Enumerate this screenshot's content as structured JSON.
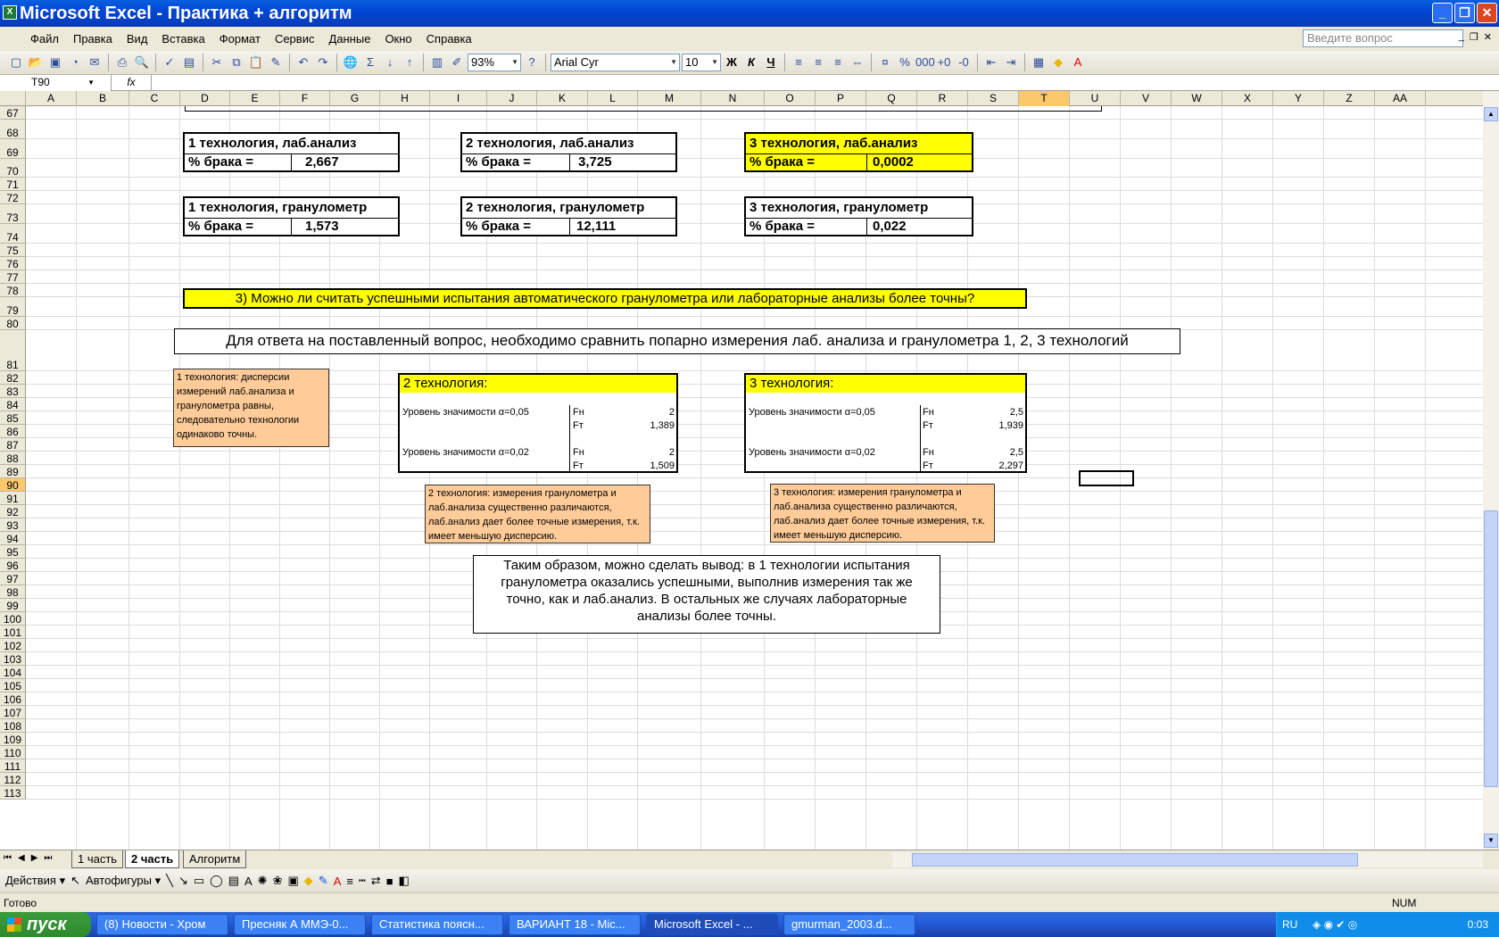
{
  "window": {
    "title": "Microsoft Excel - Практика + алгоритм"
  },
  "menu": {
    "items": [
      "Файл",
      "Правка",
      "Вид",
      "Вставка",
      "Формат",
      "Сервис",
      "Данные",
      "Окно",
      "Справка"
    ],
    "ask_placeholder": "Введите вопрос"
  },
  "toolbar": {
    "zoom": "93%",
    "font": "Arial Cyr",
    "size": "10",
    "bold": "Ж",
    "italic": "К",
    "underline": "Ч"
  },
  "formula": {
    "name_box": "T90",
    "fx": "fx",
    "content": ""
  },
  "columns": [
    "A",
    "B",
    "C",
    "D",
    "E",
    "F",
    "G",
    "H",
    "I",
    "J",
    "K",
    "L",
    "M",
    "N",
    "O",
    "P",
    "Q",
    "R",
    "S",
    "T",
    "U",
    "V",
    "W",
    "X",
    "Y",
    "Z",
    "AA"
  ],
  "rows": [
    "67",
    "68",
    "69",
    "70",
    "71",
    "72",
    "73",
    "74",
    "75",
    "76",
    "77",
    "78",
    "79",
    "80",
    "81",
    "82",
    "83",
    "84",
    "85",
    "86",
    "87",
    "88",
    "89",
    "90",
    "91",
    "92",
    "93",
    "94",
    "95",
    "96",
    "97",
    "98",
    "99",
    "100",
    "101",
    "102",
    "103",
    "104",
    "105",
    "106",
    "107",
    "108",
    "109",
    "110",
    "111",
    "112",
    "113"
  ],
  "active": {
    "column": "T",
    "row": "90"
  },
  "blocks": {
    "t1_lab": {
      "title": "1 технология, лаб.анализ",
      "label": "% брака =",
      "value": "2,667"
    },
    "t2_lab": {
      "title": "2 технология, лаб.анализ",
      "label": "% брака =",
      "value": "3,725"
    },
    "t3_lab": {
      "title": "3 технология, лаб.анализ",
      "label": "% брака =",
      "value": "0,0002"
    },
    "t1_gran": {
      "title": "1 технология, гранулометр",
      "label": "% брака =",
      "value": "1,573"
    },
    "t2_gran": {
      "title": "2 технология, гранулометр",
      "label": "% брака =",
      "value": "12,111"
    },
    "t3_gran": {
      "title": "3 технология, гранулометр",
      "label": "% брака =",
      "value": "0,022"
    }
  },
  "question": "3) Можно ли считать успешными испытания автоматического гранулометра или лабораторные анализы более точны?",
  "heading": "Для ответа на поставленный вопрос, необходимо сравнить попарно измерения лаб. анализа и гранулометра 1, 2, 3 технологий",
  "note1": "1 технология: дисперсии измерений лаб.анализа и гранулометра равны, следовательно технологии одинаково точны.",
  "tech2": {
    "title": "2 технология:",
    "l1": "Уровень значимости α=0,05",
    "fn1": "Fн",
    "fn1v": "2",
    "ft1": "Fт",
    "ft1v": "1,389",
    "l2": "Уровень значимости α=0,02",
    "fn2": "Fн",
    "fn2v": "2",
    "ft2": "Fт",
    "ft2v": "1,509"
  },
  "tech3": {
    "title": "3 технология:",
    "l1": "Уровень значимости α=0,05",
    "fn1": "Fн",
    "fn1v": "2,5",
    "ft1": "Fт",
    "ft1v": "1,939",
    "l2": "Уровень значимости α=0,02",
    "fn2": "Fн",
    "fn2v": "2,5",
    "ft2": "Fт",
    "ft2v": "2,297"
  },
  "note2": "2 технология: измерения гранулометра и лаб.анализа существенно различаются, лаб.анализ дает более точные измерения, т.к. имеет меньшую дисперсию.",
  "note3": "3 технология: измерения гранулометра и лаб.анализа существенно различаются, лаб.анализ дает более точные измерения, т.к. имеет меньшую дисперсию.",
  "conclusion": "Таким образом, можно сделать вывод: в 1 технологии испытания гранулометра оказались успешными, выполнив измерения так же точно, как и лаб.анализ. В остальных же случаях лабораторные анализы более точны.",
  "sheets": [
    "1 часть",
    "2 часть",
    "Алгоритм"
  ],
  "drawbar": {
    "actions": "Действия ▾",
    "autoshapes": "Автофигуры ▾"
  },
  "status": {
    "ready": "Готово",
    "num": "NUM"
  },
  "taskbar": {
    "start": "пуск",
    "tasks": [
      "(8) Новости - Хром",
      "Пресняк А ММЭ-0...",
      "Статистика поясн...",
      "ВАРИАНТ 18 - Mic...",
      "Microsoft Excel - ...",
      "gmurman_2003.d..."
    ],
    "lang": "RU",
    "clock": "0:03"
  }
}
